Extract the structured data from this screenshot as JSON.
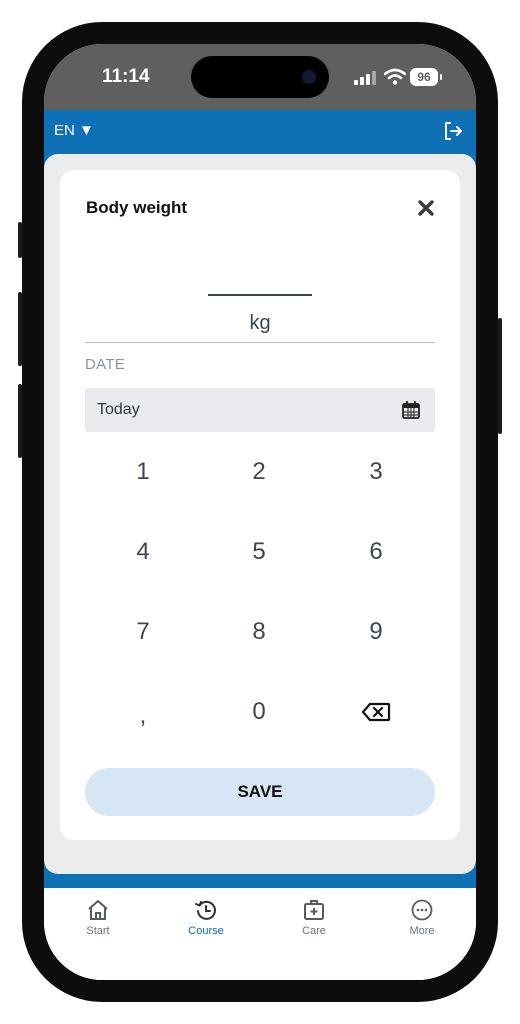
{
  "status_bar": {
    "time": "11:14",
    "battery": "96"
  },
  "app_bar": {
    "language": "EN ▼",
    "logout_icon": "logout-icon"
  },
  "modal": {
    "title": "Body weight",
    "close_icon": "close-icon",
    "weight_value": "",
    "unit": "kg",
    "date_label": "DATE",
    "date_value": "Today",
    "calendar_icon": "calendar-icon"
  },
  "keypad": {
    "keys": [
      "1",
      "2",
      "3",
      "4",
      "5",
      "6",
      "7",
      "8",
      "9",
      ",",
      "0"
    ],
    "backspace_icon": "backspace-icon"
  },
  "save_label": "SAVE",
  "colors": {
    "brand_blue": "#0e70b5",
    "save_bg": "#d7e6f5",
    "active_tab": "#0e70b5"
  },
  "tabs": [
    {
      "label": "Start",
      "icon": "home-icon",
      "active": false
    },
    {
      "label": "Course",
      "icon": "history-icon",
      "active": true
    },
    {
      "label": "Care",
      "icon": "medical-kit-icon",
      "active": false
    },
    {
      "label": "More",
      "icon": "more-icon",
      "active": false
    }
  ]
}
